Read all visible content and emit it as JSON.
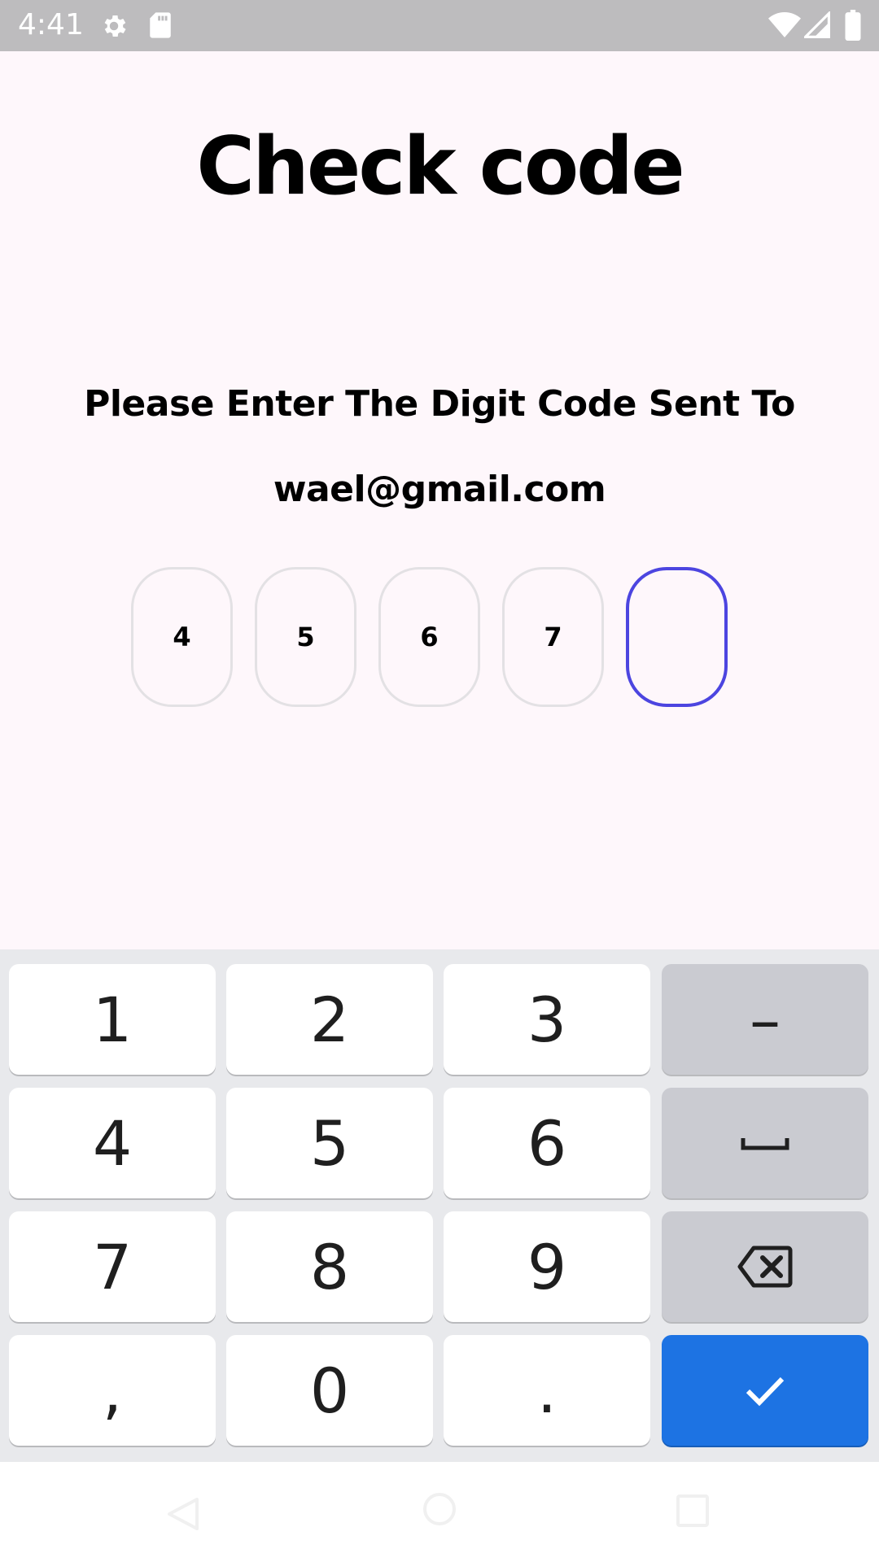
{
  "status_bar": {
    "time": "4:41",
    "icons": [
      "settings-icon",
      "sd-card-icon",
      "wifi-icon",
      "signal-icon",
      "battery-icon"
    ]
  },
  "screen": {
    "title": "Check code",
    "subtitle_line1": "Please Enter The Digit Code Sent To",
    "subtitle_line2": "wael@gmail.com"
  },
  "otp": {
    "digits": [
      "4",
      "5",
      "6",
      "7",
      ""
    ],
    "active_index": 4,
    "active_color": "#4c45e0"
  },
  "keyboard": {
    "rows": [
      [
        "1",
        "2",
        "3",
        "–"
      ],
      [
        "4",
        "5",
        "6",
        "space"
      ],
      [
        "7",
        "8",
        "9",
        "backspace"
      ],
      [
        ",",
        "0",
        ".",
        "enter"
      ]
    ],
    "keys": {
      "k1": "1",
      "k2": "2",
      "k3": "3",
      "dash": "–",
      "k4": "4",
      "k5": "5",
      "k6": "6",
      "k7": "7",
      "k8": "8",
      "k9": "9",
      "comma": ",",
      "k0": "0",
      "period": "."
    },
    "enter_color": "#1d73e3"
  },
  "nav_bar": {
    "icons": [
      "back-icon",
      "home-icon",
      "recents-icon"
    ]
  }
}
